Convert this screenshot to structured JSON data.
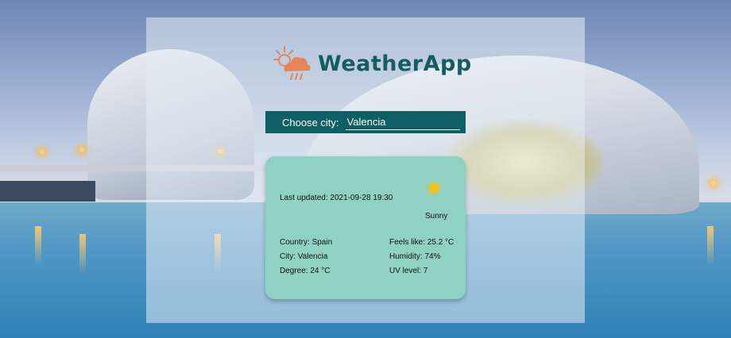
{
  "app": {
    "brand_name": "WeatherApp",
    "brand_color": "#145e62",
    "logo_icon": "sun-cloud-rain-icon"
  },
  "city_selector": {
    "label": "Choose city:",
    "value": "Valencia",
    "bar_color": "#0d5f63"
  },
  "weather": {
    "card_color": "#8fd1c3",
    "last_updated": "Last updated: 2021-09-28 19:30",
    "condition": "Sunny",
    "condition_icon": "sun-icon",
    "details_left": [
      "Country: Spain",
      "City: Valencia",
      "Degree: 24 °C"
    ],
    "details_right": [
      "Feels like: 25.2 °C",
      "Humidity: 74%",
      "UV level: 7"
    ]
  }
}
